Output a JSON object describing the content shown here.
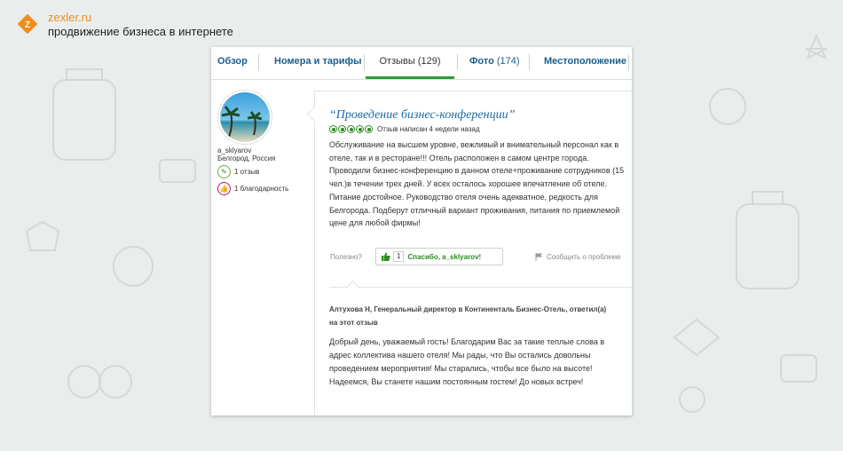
{
  "brand": {
    "name": "zexler.ru",
    "tagline": "продвижение бизнеса в интернете",
    "accent": "#f08c1a"
  },
  "tabs": [
    {
      "label": "Обзор",
      "count": ""
    },
    {
      "label": "Номера и тарифы",
      "count": ""
    },
    {
      "label": "Отзывы",
      "count": "(129)"
    },
    {
      "label": "Фото",
      "count": "(174)"
    },
    {
      "label": "Местоположение",
      "count": ""
    }
  ],
  "reviewer": {
    "username": "a_sklyarov",
    "location": "Белгород, Россия",
    "reviews": "1 отзыв",
    "thanks": "1 благодарность"
  },
  "review": {
    "title": "“Проведение бизнес-конференции”",
    "rating": 5,
    "date": "Отзыв написан 4 недели назад",
    "body": "Обслуживание на высшем уровне, вежливый и внимательный персонал как в отеле, так и в ресторане!!! Отель расположен в самом центре города. Проводили бизнес-конференцию в данном отеле+проживание сотрудников (15 чел.)в течении трех дней. У всех осталось хорошее впечатление об отеле. Питание достойное. Руководство отеля очень адекватное, редкость для Белгорода. Подберут отличный вариант проживания, питания по приемлемой цене для любой фирмы!",
    "helpful_label": "Полезно?",
    "thanks_count": "1",
    "thanks_label": "Спасибо, a_sklyarov!",
    "report_label": "Сообщить о проблеме"
  },
  "response": {
    "author": "Алтухова Н, Генеральный директор в Континенталь Бизнес-Отель, ответил(а) на этот отзыв",
    "body": "Добрый день, уважаемый гость! Благодарим Вас за такие теплые слова в адрес коллектива нашего отеля! Мы рады, что Вы остались довольны проведением мероприятия! Мы старались, чтобы все было на высоте! Надеемся, Вы станете нашим постоянным гостем! До новых встреч!"
  },
  "colors": {
    "tab_active_underline": "#2e9d3a",
    "link": "#1f6aa5",
    "rating": "#2e8b22"
  }
}
